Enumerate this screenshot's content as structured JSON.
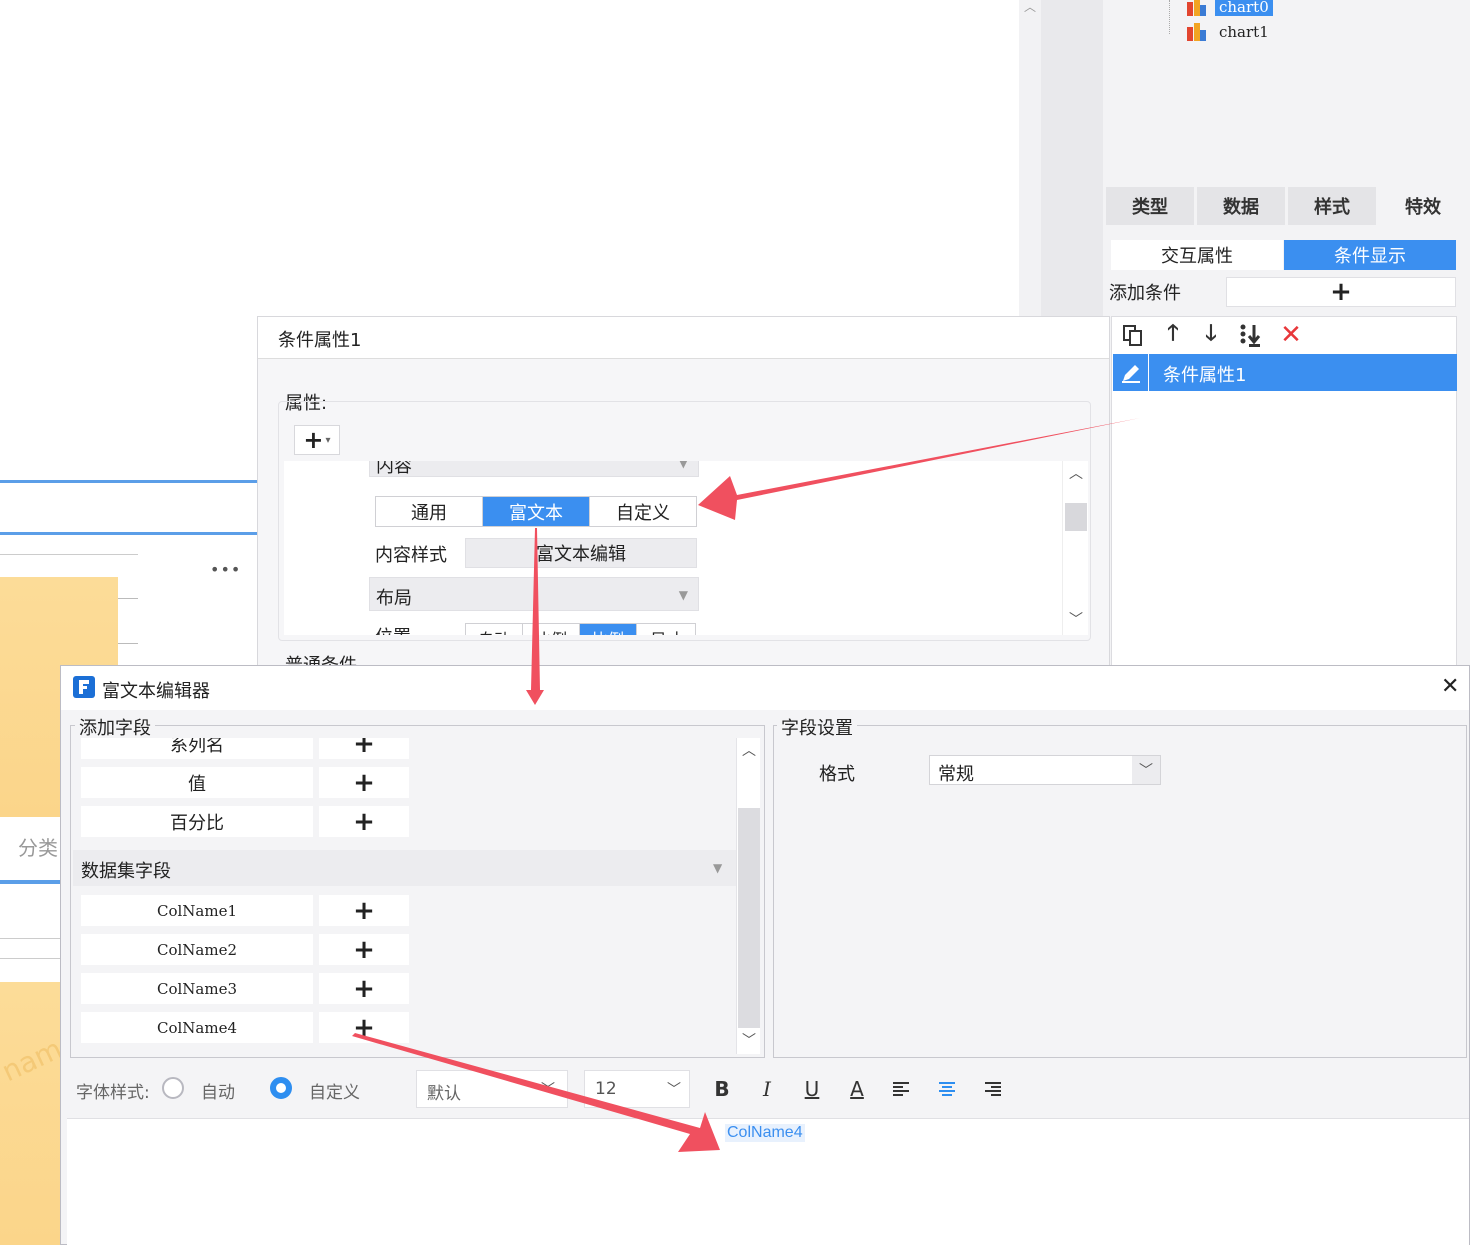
{
  "tree": {
    "items": [
      {
        "label": "chart0",
        "selected": true
      },
      {
        "label": "chart1",
        "selected": false
      }
    ]
  },
  "right_panel": {
    "tabs": [
      "类型",
      "数据",
      "样式",
      "特效"
    ],
    "subtabs": [
      "交互属性",
      "条件显示"
    ],
    "add_condition_label": "添加条件",
    "add_symbol": "+",
    "condition_item": "条件属性1"
  },
  "condition_dialog": {
    "title": "条件属性1",
    "attr_label": "属性:",
    "add_symbol": "+",
    "content_label": "内容",
    "modes": [
      "通用",
      "富文本",
      "自定义"
    ],
    "content_style_label": "内容样式",
    "content_style_button": "富文本编辑",
    "layout_label": "布局",
    "position_label": "位置",
    "position_options": [
      "自动",
      "比例",
      "比例",
      "尺寸"
    ],
    "normal_condition_label": "普通条件"
  },
  "background": {
    "more": "•••",
    "category_label": "分类",
    "ghost_text": "name"
  },
  "rte": {
    "title": "富文本编辑器",
    "close": "✕",
    "add_fields_title": "添加字段",
    "series_fields": [
      "系列名",
      "值",
      "百分比"
    ],
    "dataset_section": "数据集字段",
    "dataset_fields": [
      "ColName1",
      "ColName2",
      "ColName3",
      "ColName4"
    ],
    "field_settings_title": "字段设置",
    "format_label": "格式",
    "format_value": "常规",
    "font_style_label": "字体样式:",
    "radio_auto": "自动",
    "radio_custom": "自定义",
    "font_family": "默认",
    "font_size": "12",
    "toolbar": {
      "bold": "B",
      "italic": "I",
      "underline": "U",
      "color": "A"
    },
    "editor_content": "ColName4"
  },
  "colors": {
    "accent": "#3b8ff0",
    "arrow": "#f0505f",
    "chart_bar": "#fbd588"
  }
}
